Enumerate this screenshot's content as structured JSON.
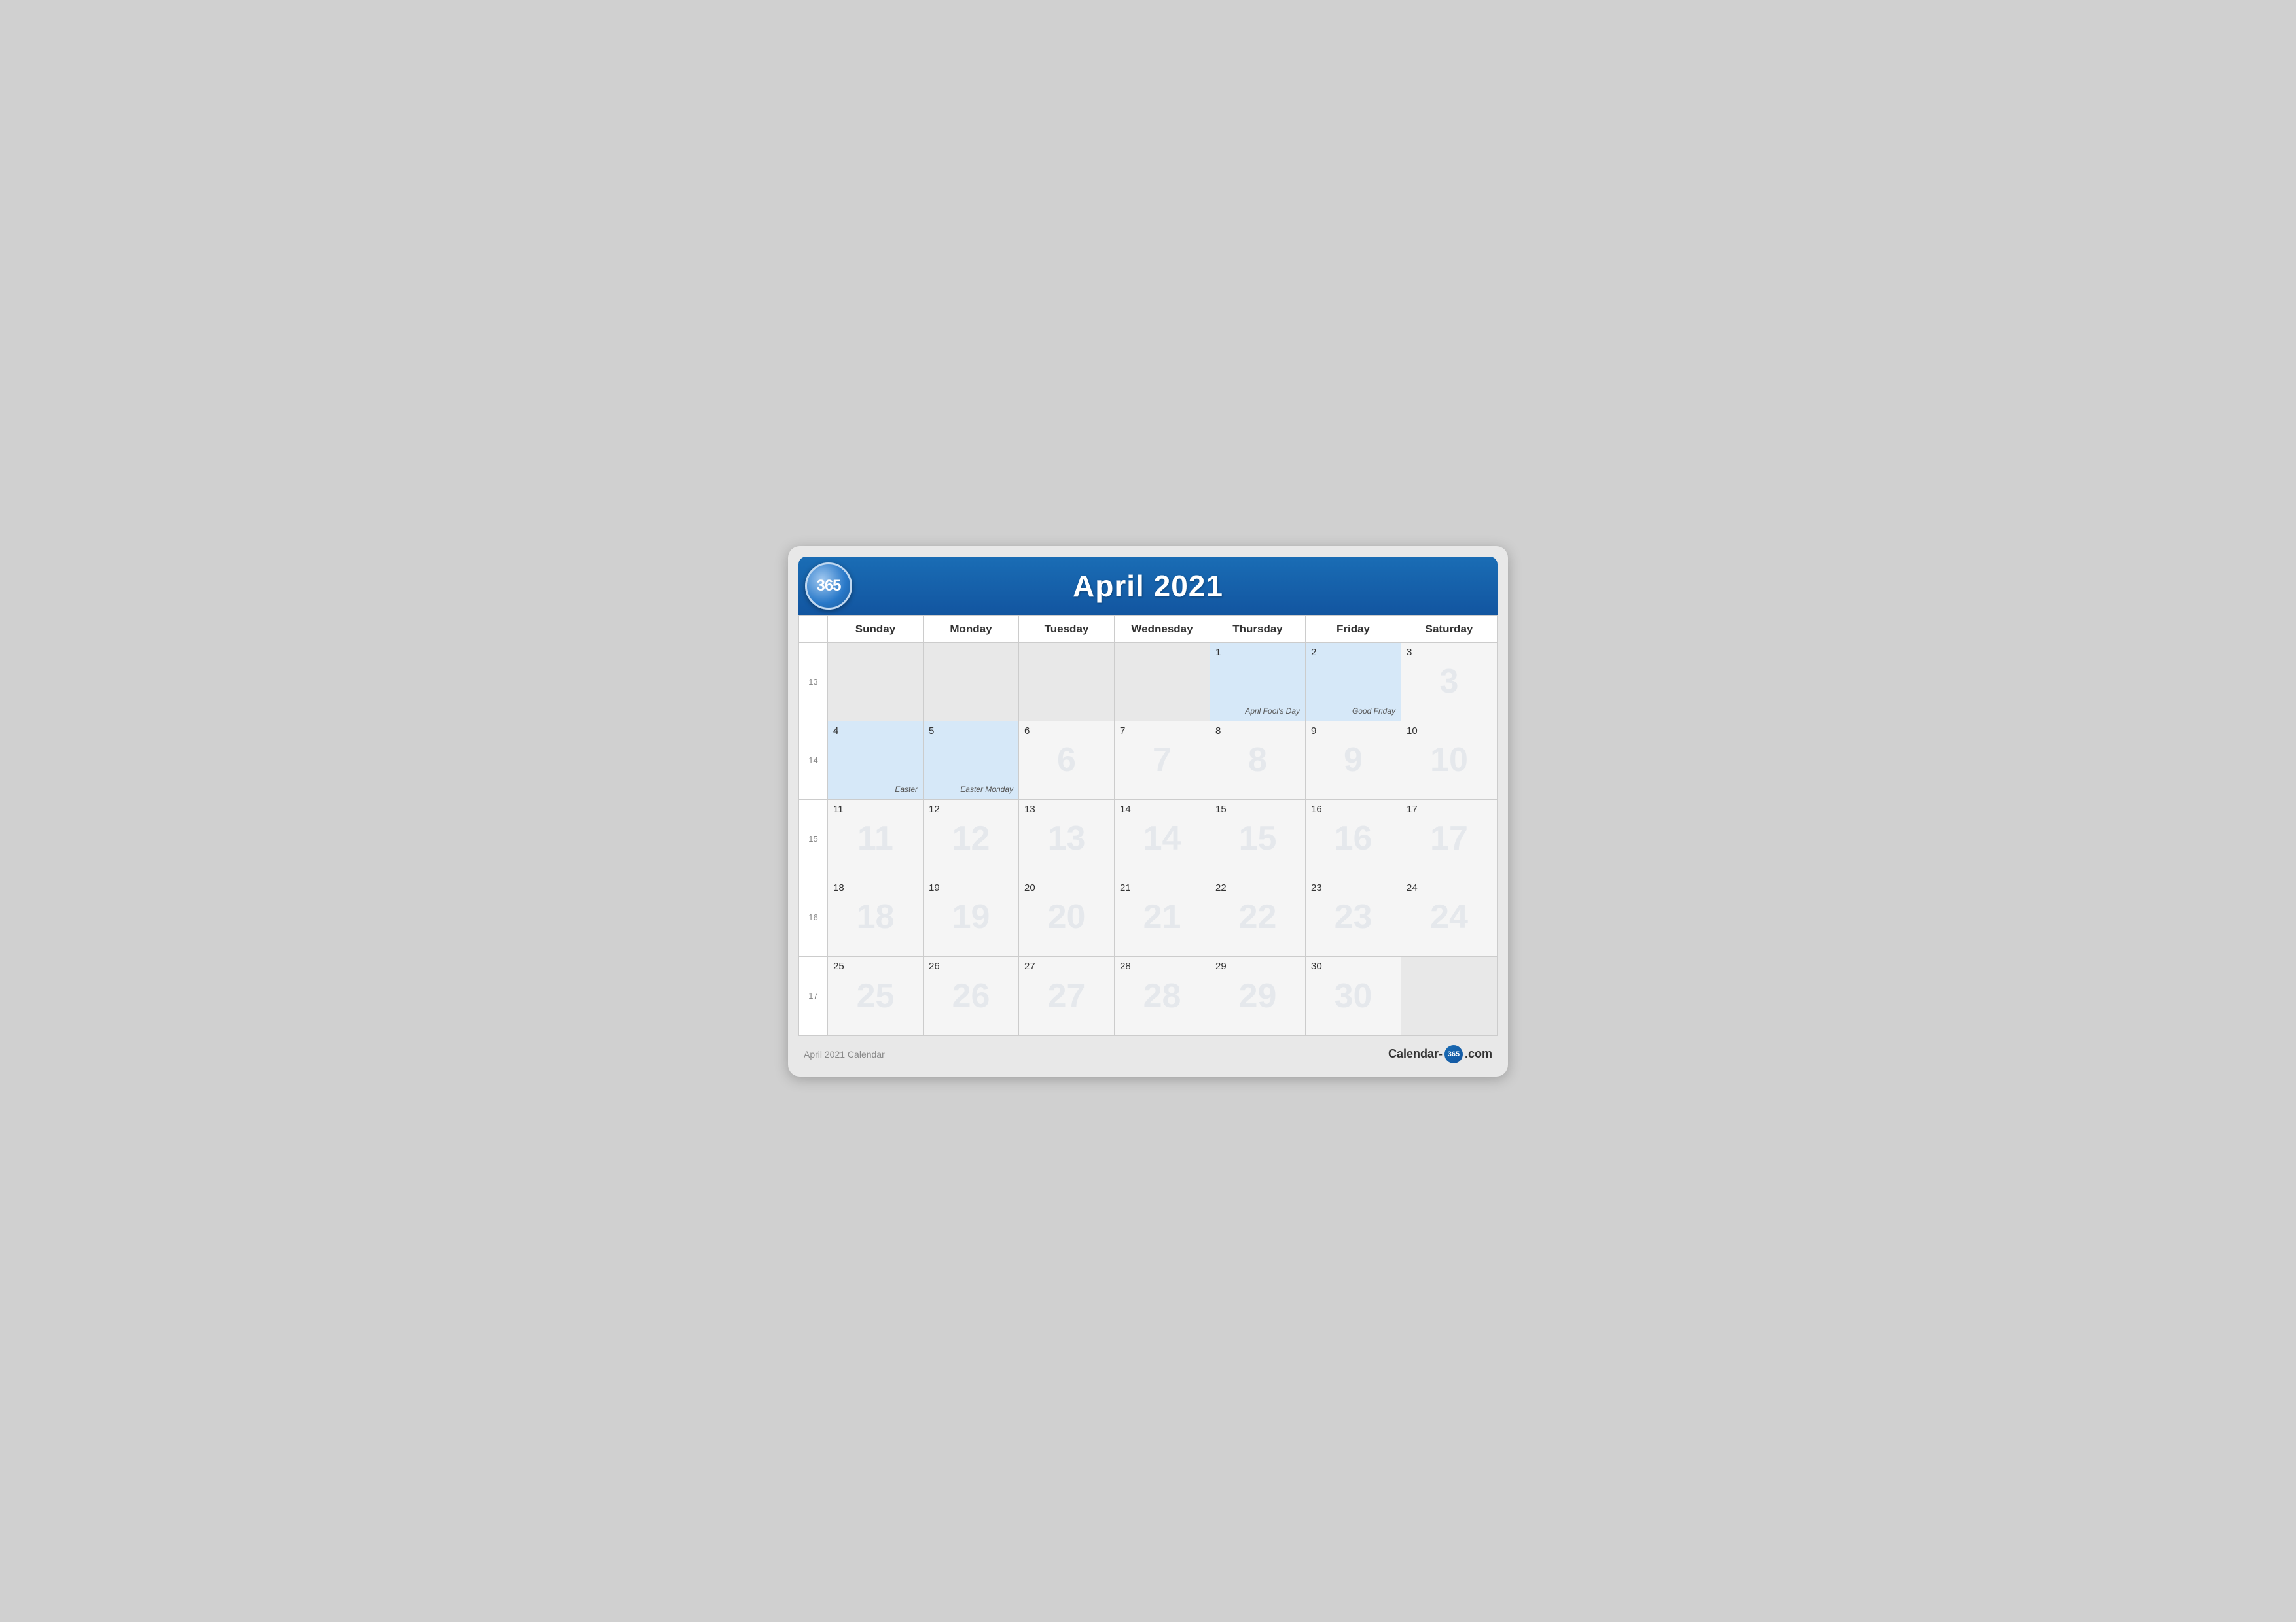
{
  "header": {
    "logo": "365",
    "title": "April 2021"
  },
  "dayHeaders": [
    "Sunday",
    "Monday",
    "Tuesday",
    "Wednesday",
    "Thursday",
    "Friday",
    "Saturday"
  ],
  "weeks": [
    {
      "weekNum": "13",
      "days": [
        {
          "date": "",
          "inMonth": false,
          "highlighted": false,
          "holiday": ""
        },
        {
          "date": "",
          "inMonth": false,
          "highlighted": false,
          "holiday": ""
        },
        {
          "date": "",
          "inMonth": false,
          "highlighted": false,
          "holiday": ""
        },
        {
          "date": "",
          "inMonth": false,
          "highlighted": false,
          "holiday": ""
        },
        {
          "date": "1",
          "inMonth": true,
          "highlighted": true,
          "holiday": "April Fool's Day"
        },
        {
          "date": "2",
          "inMonth": true,
          "highlighted": true,
          "holiday": "Good Friday"
        },
        {
          "date": "3",
          "inMonth": true,
          "highlighted": false,
          "holiday": ""
        }
      ]
    },
    {
      "weekNum": "14",
      "days": [
        {
          "date": "4",
          "inMonth": true,
          "highlighted": true,
          "holiday": "Easter"
        },
        {
          "date": "5",
          "inMonth": true,
          "highlighted": true,
          "holiday": "Easter Monday"
        },
        {
          "date": "6",
          "inMonth": true,
          "highlighted": false,
          "holiday": ""
        },
        {
          "date": "7",
          "inMonth": true,
          "highlighted": false,
          "holiday": ""
        },
        {
          "date": "8",
          "inMonth": true,
          "highlighted": false,
          "holiday": ""
        },
        {
          "date": "9",
          "inMonth": true,
          "highlighted": false,
          "holiday": ""
        },
        {
          "date": "10",
          "inMonth": true,
          "highlighted": false,
          "holiday": ""
        }
      ]
    },
    {
      "weekNum": "15",
      "days": [
        {
          "date": "11",
          "inMonth": true,
          "highlighted": false,
          "holiday": ""
        },
        {
          "date": "12",
          "inMonth": true,
          "highlighted": false,
          "holiday": ""
        },
        {
          "date": "13",
          "inMonth": true,
          "highlighted": false,
          "holiday": ""
        },
        {
          "date": "14",
          "inMonth": true,
          "highlighted": false,
          "holiday": ""
        },
        {
          "date": "15",
          "inMonth": true,
          "highlighted": false,
          "holiday": ""
        },
        {
          "date": "16",
          "inMonth": true,
          "highlighted": false,
          "holiday": ""
        },
        {
          "date": "17",
          "inMonth": true,
          "highlighted": false,
          "holiday": ""
        }
      ]
    },
    {
      "weekNum": "16",
      "days": [
        {
          "date": "18",
          "inMonth": true,
          "highlighted": false,
          "holiday": ""
        },
        {
          "date": "19",
          "inMonth": true,
          "highlighted": false,
          "holiday": ""
        },
        {
          "date": "20",
          "inMonth": true,
          "highlighted": false,
          "holiday": ""
        },
        {
          "date": "21",
          "inMonth": true,
          "highlighted": false,
          "holiday": ""
        },
        {
          "date": "22",
          "inMonth": true,
          "highlighted": false,
          "holiday": ""
        },
        {
          "date": "23",
          "inMonth": true,
          "highlighted": false,
          "holiday": ""
        },
        {
          "date": "24",
          "inMonth": true,
          "highlighted": false,
          "holiday": ""
        }
      ]
    },
    {
      "weekNum": "17",
      "days": [
        {
          "date": "25",
          "inMonth": true,
          "highlighted": false,
          "holiday": ""
        },
        {
          "date": "26",
          "inMonth": true,
          "highlighted": false,
          "holiday": ""
        },
        {
          "date": "27",
          "inMonth": true,
          "highlighted": false,
          "holiday": ""
        },
        {
          "date": "28",
          "inMonth": true,
          "highlighted": false,
          "holiday": ""
        },
        {
          "date": "29",
          "inMonth": true,
          "highlighted": false,
          "holiday": ""
        },
        {
          "date": "30",
          "inMonth": true,
          "highlighted": false,
          "holiday": ""
        },
        {
          "date": "",
          "inMonth": false,
          "highlighted": false,
          "holiday": ""
        }
      ]
    }
  ],
  "watermarks": {
    "week1": "",
    "week2": "",
    "week3": "",
    "week4": "",
    "week5": ""
  },
  "footer": {
    "caption": "April 2021 Calendar",
    "brand_before": "Calendar-",
    "brand_badge": "365",
    "brand_after": ".com"
  }
}
